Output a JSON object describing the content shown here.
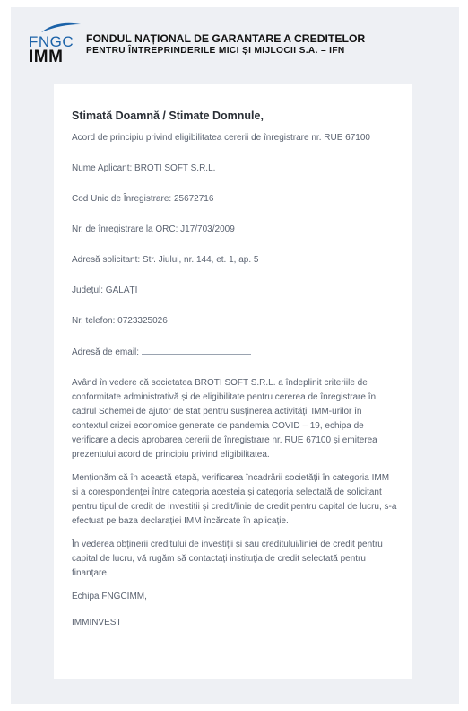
{
  "header": {
    "logo_top": "FNGC",
    "logo_bottom": "IMM",
    "org_line1": "FONDUL NAȚIONAL DE GARANTARE A CREDITELOR",
    "org_line2": "PENTRU ÎNTREPRINDERILE MICI ȘI MIJLOCII S.A. – IFN"
  },
  "letter": {
    "greeting": "Stimată Doamnă / Stimate Domnule,",
    "subject": "Acord de principiu privind eligibilitatea cererii de înregistrare nr. RUE 67100",
    "applicant": "Nume Aplicant: BROTI SOFT S.R.L.",
    "cui": "Cod Unic de Înregistrare: 25672716",
    "orc": "Nr. de înregistrare la ORC: J17/703/2009",
    "address": "Adresă solicitant: Str. Jiului, nr. 144, et. 1, ap. 5",
    "county": "Județul: GALAȚI",
    "phone": "Nr. telefon: 0723325026",
    "email_label": "Adresă de email:",
    "paragraph1": "Având în vedere că societatea BROTI SOFT S.R.L. a îndeplinit criteriile de conformitate administrativă și de eligibilitate pentru cererea de înregistrare în cadrul Schemei de ajutor de stat pentru susținerea activității IMM-urilor în contextul crizei economice generate de pandemia COVID – 19, echipa de verificare a decis aprobarea cererii de înregistrare nr. RUE 67100 și emiterea prezentului acord de principiu privind eligibilitatea.",
    "paragraph2": "Menționăm că în această etapă, verificarea încadrării societății în categoria IMM și a corespondenței între categoria acesteia și categoria selectată de solicitant pentru tipul de credit de investiții și credit/linie de credit pentru capital de lucru, s-a efectuat pe baza declarației IMM încărcate în aplicație.",
    "paragraph3": "În vederea obținerii creditului de investiții și sau creditului/liniei de credit pentru capital de lucru, vă rugăm să contactați instituția de credit selectată pentru finanțare.",
    "sign1": "Echipa FNGCIMM,",
    "sign2": "IMMINVEST"
  },
  "colors": {
    "brand_blue": "#1b62a8",
    "text_gray": "#5a6270",
    "frame_bg": "#eef0f4"
  }
}
